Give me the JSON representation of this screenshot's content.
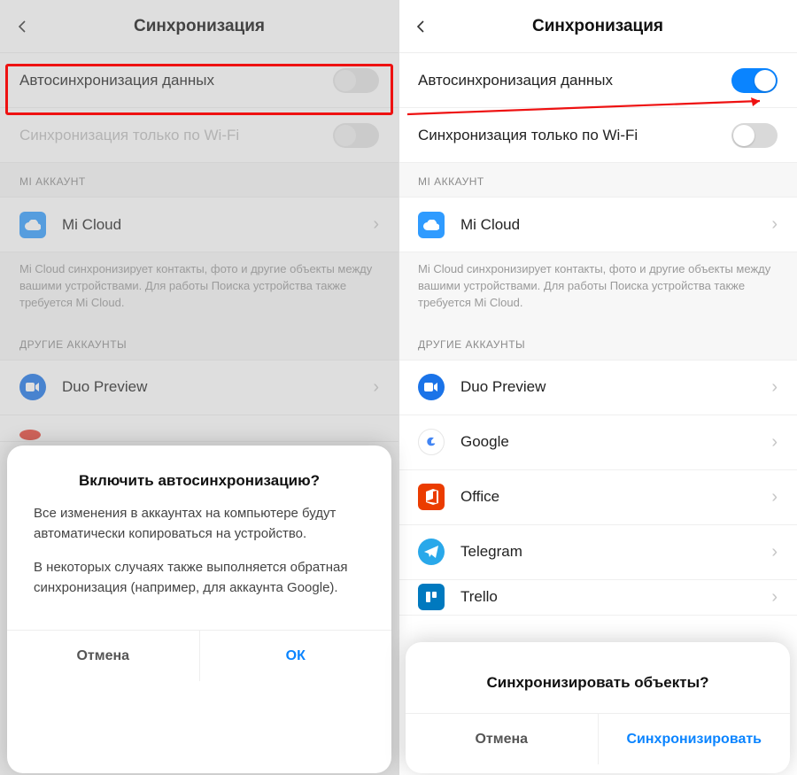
{
  "left": {
    "header_title": "Синхронизация",
    "autosync_label": "Автосинхронизация данных",
    "wifi_label": "Синхронизация только по Wi-Fi",
    "section_mi": "MI АККАУНТ",
    "micloud": "Mi Cloud",
    "micloud_desc": "Mi Cloud синхронизирует контакты, фото и другие объекты между вашими устройствами. Для работы Поиска устройства также требуется Mi Cloud.",
    "section_other": "ДРУГИЕ АККАУНТЫ",
    "duo": "Duo Preview",
    "dialog": {
      "title": "Включить автосинхронизацию?",
      "p1": "Все изменения в аккаунтах на компьютере будут автоматически копироваться на устройство.",
      "p2": "В некоторых случаях также выполняется обратная синхронизация (например, для аккаунта Google).",
      "cancel": "Отмена",
      "ok": "ОК"
    }
  },
  "right": {
    "header_title": "Синхронизация",
    "autosync_label": "Автосинхронизация данных",
    "wifi_label": "Синхронизация только по Wi-Fi",
    "section_mi": "MI АККАУНТ",
    "micloud": "Mi Cloud",
    "micloud_desc": "Mi Cloud синхронизирует контакты, фото и другие объекты между вашими устройствами. Для работы Поиска устройства также требуется Mi Cloud.",
    "section_other": "ДРУГИЕ АККАУНТЫ",
    "duo": "Duo Preview",
    "google": "Google",
    "office": "Office",
    "telegram": "Telegram",
    "trello": "Trello",
    "dialog": {
      "title": "Синхронизировать объекты?",
      "cancel": "Отмена",
      "ok": "Синхронизировать"
    }
  }
}
